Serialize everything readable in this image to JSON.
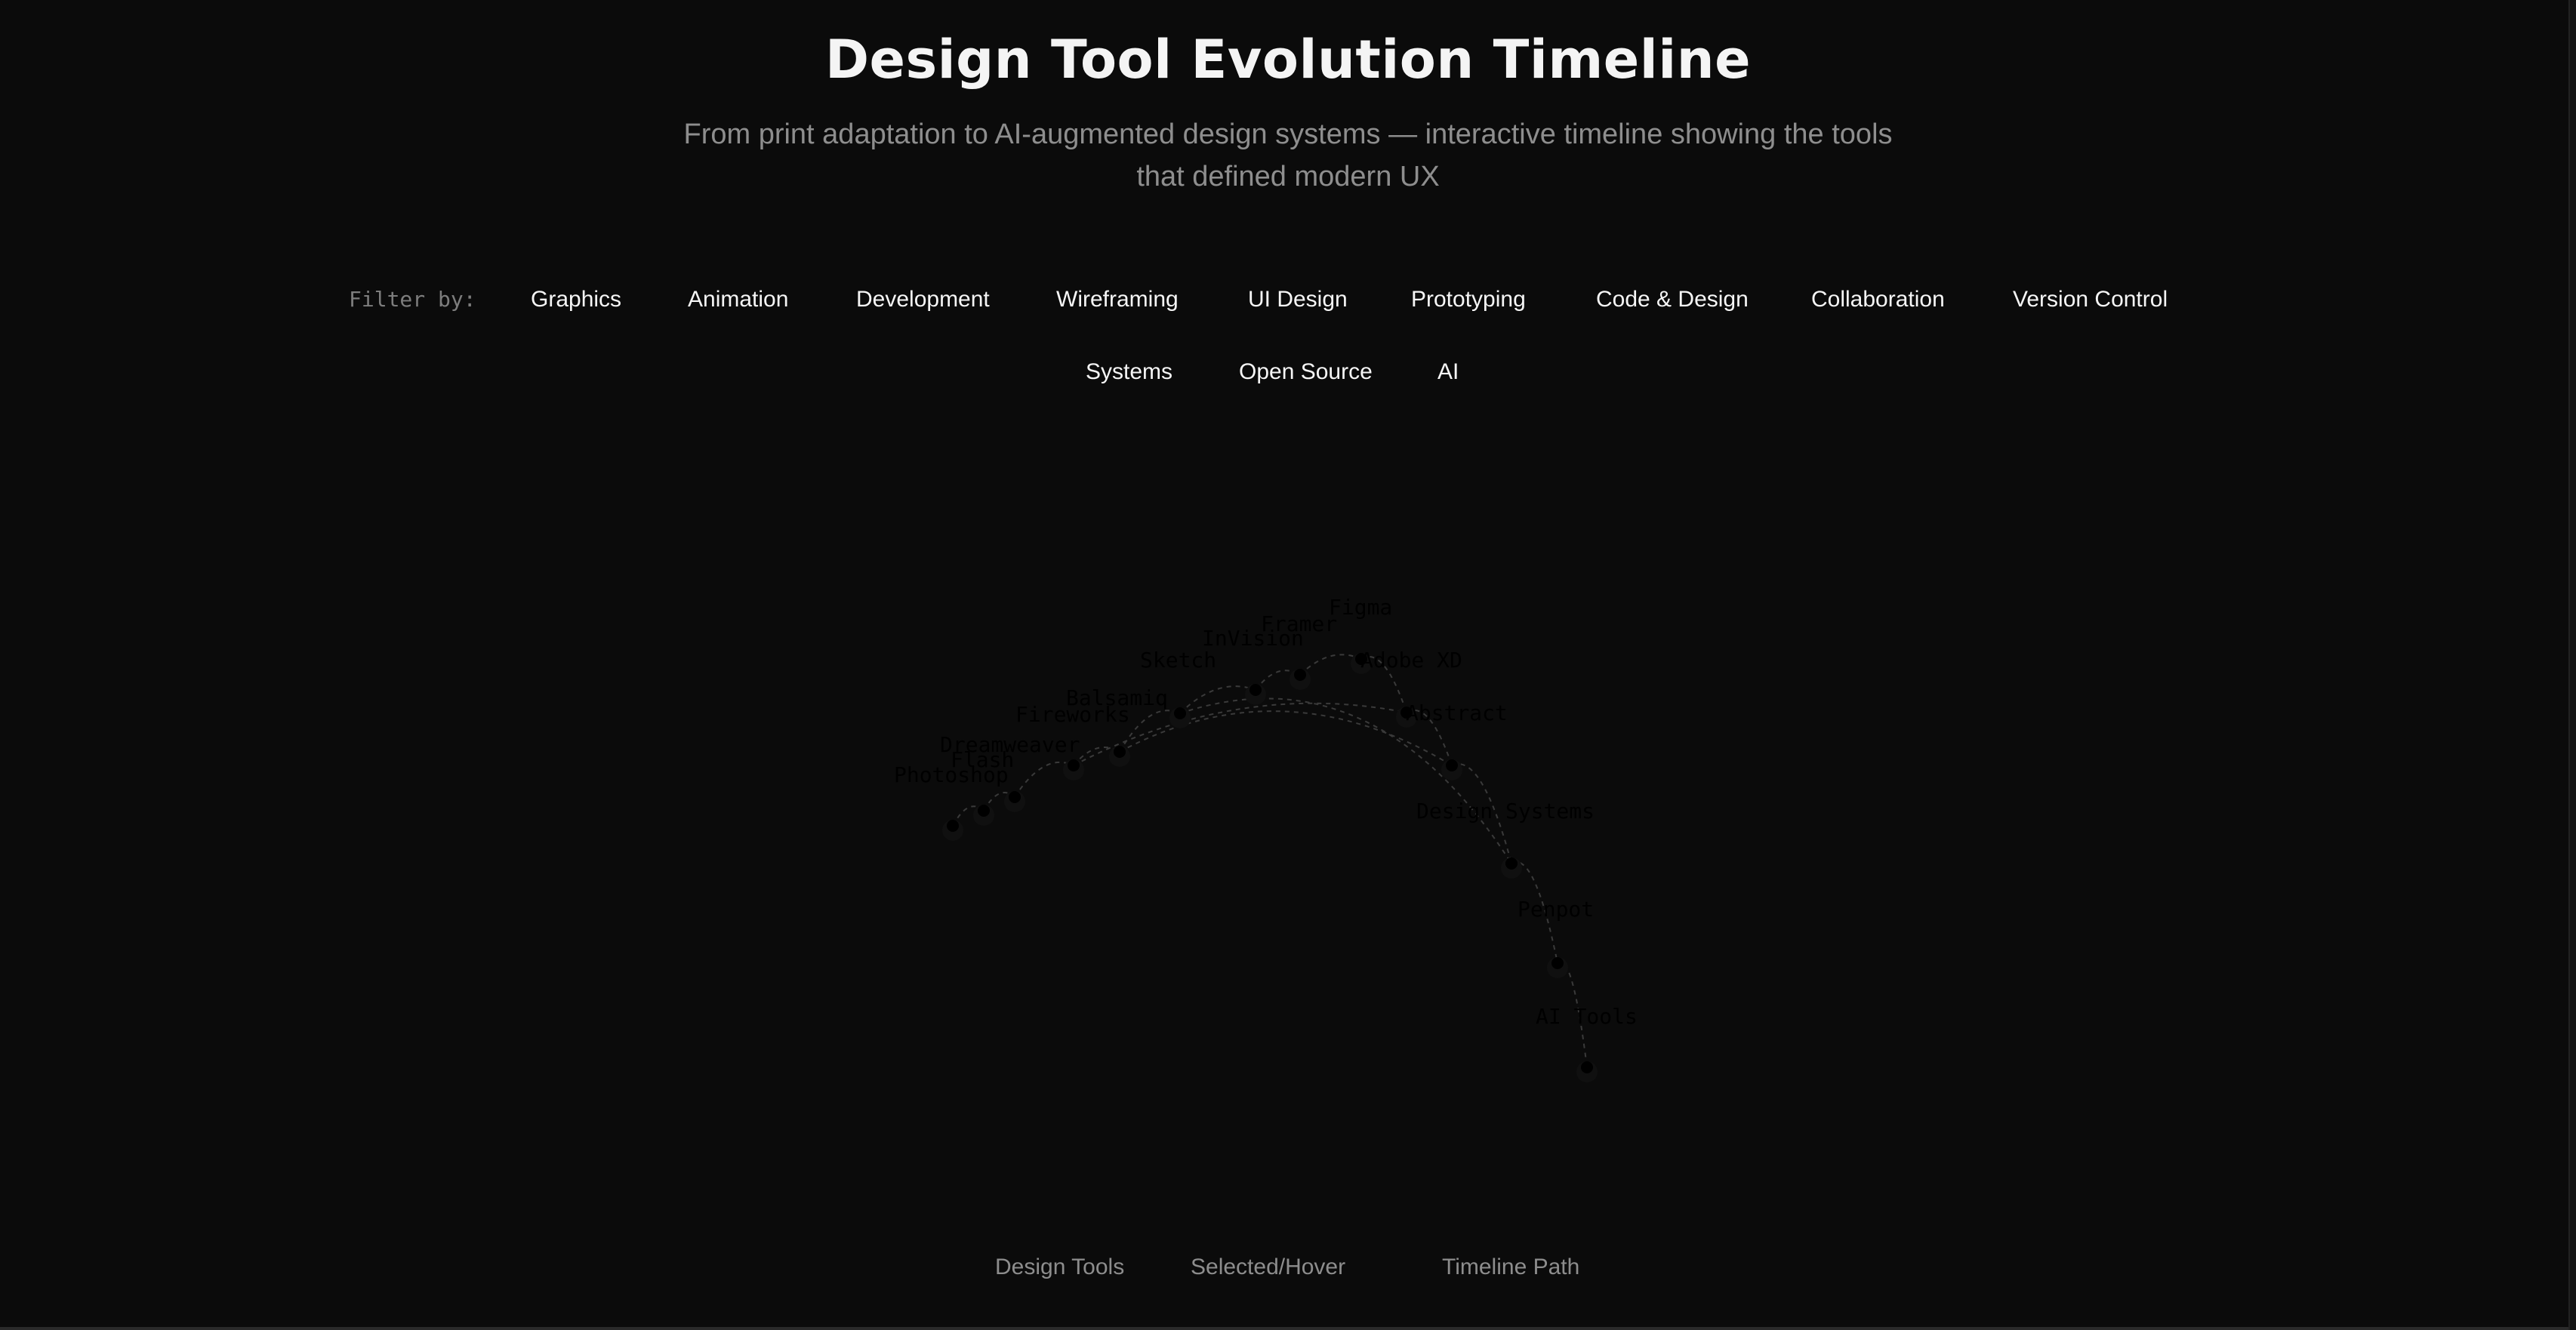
{
  "header": {
    "title": "Design Tool Evolution Timeline",
    "subtitle": "From print adaptation to AI-augmented design systems — interactive timeline showing the tools that defined modern UX"
  },
  "filters": {
    "label": "Filter by:",
    "chips": [
      "Graphics",
      "Animation",
      "Development",
      "Wireframing",
      "UI Design",
      "Prototyping",
      "Code & Design",
      "Collaboration",
      "Version Control",
      "Systems",
      "Open Source",
      "AI"
    ]
  },
  "timeline": {
    "tools": [
      "Photoshop",
      "Flash",
      "Dreamweaver",
      "Fireworks",
      "Balsamiq",
      "Sketch",
      "InVision",
      "Framer",
      "Figma",
      "Adobe XD",
      "Abstract",
      "Design Systems",
      "Penpot",
      "AI Tools"
    ]
  },
  "legend": {
    "items": [
      "Design Tools",
      "Selected/Hover",
      "Timeline Path"
    ]
  },
  "colors": {
    "background": "#0b0b0b",
    "title": "#f4f4f4",
    "subtitle": "#8e8e8e",
    "chip_text": "#f6f6f6",
    "node": "#000000",
    "path": "#3a3a3a"
  }
}
